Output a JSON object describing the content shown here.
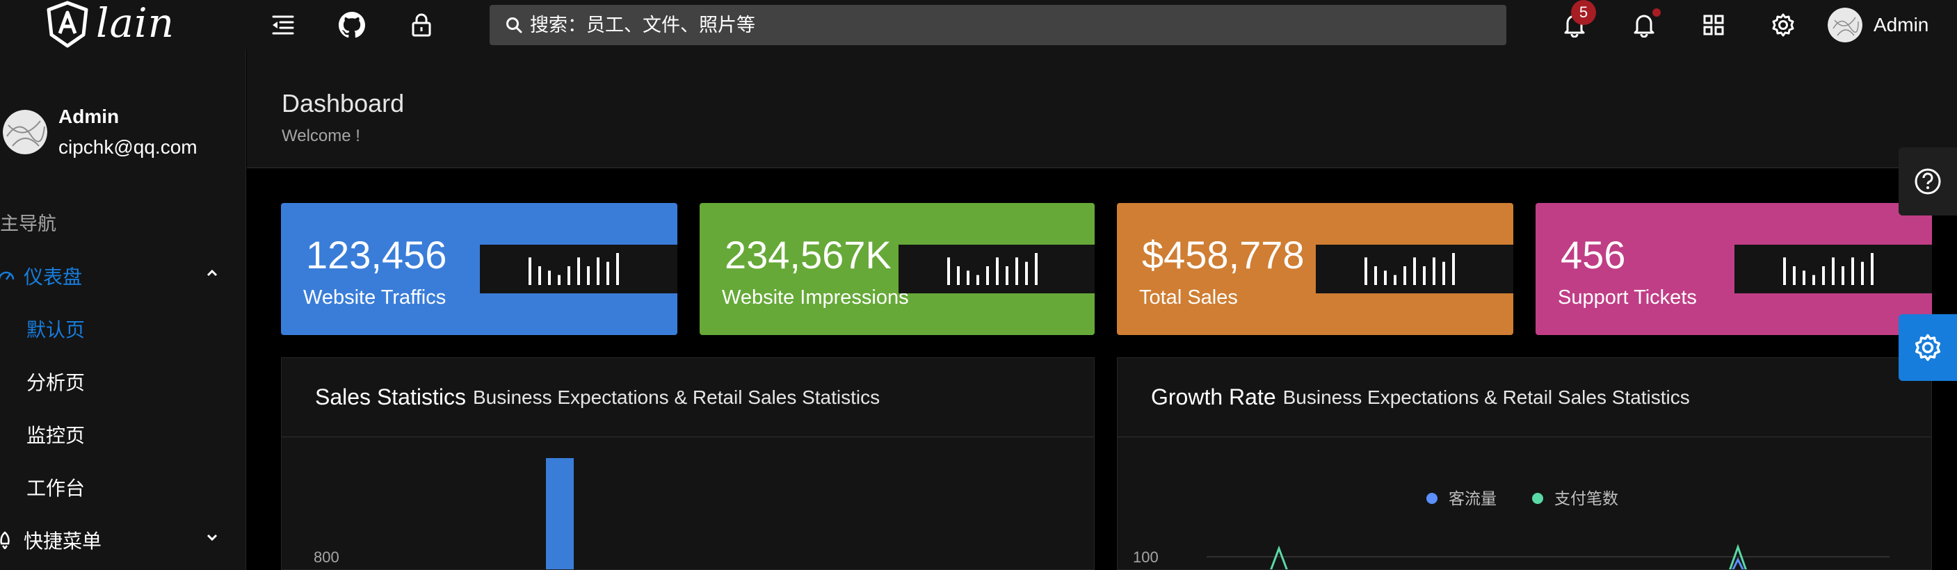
{
  "header": {
    "logo_text": "lain",
    "search_placeholder": "搜索：员工、文件、照片等",
    "notification_count": "5",
    "user_name": "Admin"
  },
  "sidebar": {
    "user": {
      "name": "Admin",
      "email": "cipchk@qq.com"
    },
    "group_title": "主导航",
    "dashboard": "仪表盘",
    "items": [
      "默认页",
      "分析页",
      "监控页",
      "工作台"
    ],
    "shortcut": "快捷菜单"
  },
  "page": {
    "title": "Dashboard",
    "subtitle": "Welcome !"
  },
  "stats": [
    {
      "value": "123,456",
      "label": "Website Traffics",
      "color": "#3a7dd9"
    },
    {
      "value": "234,567K",
      "label": "Website Impressions",
      "color": "#66a938"
    },
    {
      "value": "$458,778",
      "label": "Total Sales",
      "color": "#cf7e33"
    },
    {
      "value": "456",
      "label": "Support Tickets",
      "color": "#c03e86"
    }
  ],
  "sparkline_values": [
    5,
    3,
    2,
    1,
    3,
    5,
    3,
    5,
    4,
    6
  ],
  "panels": {
    "sales": {
      "title": "Sales Statistics",
      "subtitle": "Business Expectations & Retail Sales Statistics",
      "tick": "800"
    },
    "growth": {
      "title": "Growth Rate",
      "subtitle": "Business Expectations & Retail Sales Statistics",
      "legend": [
        "客流量",
        "支付笔数"
      ],
      "tick": "100"
    }
  },
  "colors": {
    "accent": "#177ddc",
    "badge": "#a61d24",
    "series_a": "#5b8ff9",
    "series_b": "#5ad8a6"
  }
}
